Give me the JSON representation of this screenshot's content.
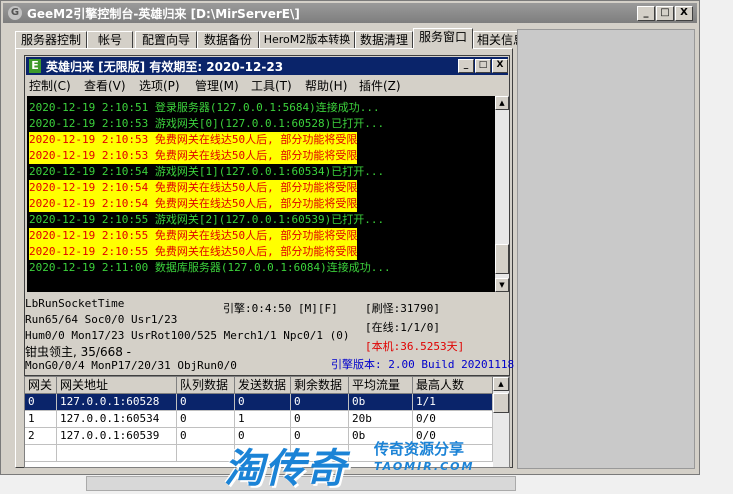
{
  "window": {
    "title": "GeeM2引擎控制台-英雄归来 [D:\\MirServerE\\]",
    "buttons": [
      "_",
      "□",
      "X"
    ]
  },
  "tabs": [
    {
      "label": "服务器控制",
      "active": false
    },
    {
      "label": "帐号",
      "active": false
    },
    {
      "label": "配置向导",
      "active": false
    },
    {
      "label": "数据备份",
      "active": false
    },
    {
      "label": "HeroM2版本转换",
      "active": false
    },
    {
      "label": "数据清理",
      "active": false
    },
    {
      "label": "服务窗口",
      "active": true
    },
    {
      "label": "相关信息",
      "active": false
    }
  ],
  "inner_window": {
    "title": "英雄归来 [无限版] 有效期至: 2020-12-23",
    "icon": "E",
    "buttons": [
      "_",
      "□",
      "X"
    ],
    "menu": [
      "控制(C)",
      "查看(V)",
      "选项(P)",
      "管理(M)",
      "工具(T)",
      "帮助(H)",
      "插件(Z)"
    ]
  },
  "log": [
    {
      "text": "2020-12-19 2:10:51 登录服务器(127.0.0.1:5684)连接成功...",
      "type": "info"
    },
    {
      "text": "2020-12-19 2:10:53 游戏网关[0](127.0.0.1:60528)已打开...",
      "type": "info"
    },
    {
      "text": "2020-12-19 2:10:53 免费网关在线达50人后, 部分功能将受限",
      "type": "warn"
    },
    {
      "text": "2020-12-19 2:10:53 免费网关在线达50人后, 部分功能将受限",
      "type": "warn"
    },
    {
      "text": "2020-12-19 2:10:54 游戏网关[1](127.0.0.1:60534)已打开...",
      "type": "info"
    },
    {
      "text": "2020-12-19 2:10:54 免费网关在线达50人后, 部分功能将受限",
      "type": "warn"
    },
    {
      "text": "2020-12-19 2:10:54 免费网关在线达50人后, 部分功能将受限",
      "type": "warn"
    },
    {
      "text": "2020-12-19 2:10:55 游戏网关[2](127.0.0.1:60539)已打开...",
      "type": "info"
    },
    {
      "text": "2020-12-19 2:10:55 免费网关在线达50人后, 部分功能将受限",
      "type": "warn"
    },
    {
      "text": "2020-12-19 2:10:55 免费网关在线达50人后, 部分功能将受限",
      "type": "warn"
    },
    {
      "text": "2020-12-19 2:11:00 数据库服务器(127.0.0.1:6084)连接成功...",
      "type": "info"
    }
  ],
  "status": {
    "line1": "LbRunSocketTime",
    "line2": "Run65/64 Soc0/0 Usr1/23",
    "line3": "Hum0/0 Mon17/23 UsrRot100/525 Merch1/1 Npc0/1 (0)",
    "line4": "钳虫领主, 35/668 -",
    "line5": "MonG0/0/4 MonP17/20/31 ObjRun0/0",
    "engine_time": "引擎:0:4:50 [M][F]",
    "refresh": "[刷怪:31790]",
    "online": "[在线:1/1/0]",
    "machine": "[本机:36.5253天]",
    "version": "引擎版本: 2.00 Build 20201118",
    "colors": {
      "machine": "#e00000",
      "version": "#0000cc"
    }
  },
  "gate_table": {
    "headers": [
      "网关",
      "网关地址",
      "队列数据",
      "发送数据",
      "剩余数据",
      "平均流量",
      "最高人数"
    ],
    "rows": [
      [
        "0",
        "127.0.0.1:60528",
        "0",
        "0",
        "0",
        "0b",
        "1/1"
      ],
      [
        "1",
        "127.0.0.1:60534",
        "0",
        "1",
        "0",
        "20b",
        "0/0"
      ],
      [
        "2",
        "127.0.0.1:60539",
        "0",
        "0",
        "0",
        "0b",
        "0/0"
      ]
    ],
    "selected_row": 0
  },
  "watermark": {
    "brand": "淘传奇",
    "tagline": "传奇资源分享",
    "url": "TAOMIR.COM"
  }
}
